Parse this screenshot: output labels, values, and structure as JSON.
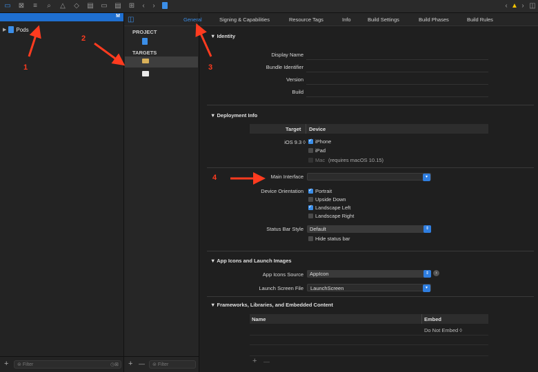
{
  "navigator": {
    "selected_badge": "M",
    "root_item": "Pods",
    "filter_placeholder": "Filter"
  },
  "target_list": {
    "project_header": "PROJECT",
    "targets_header": "TARGETS",
    "filter_placeholder": "Filter",
    "add_label": "+",
    "remove_label": "—"
  },
  "tabs": [
    {
      "label": "General",
      "active": true
    },
    {
      "label": "Signing & Capabilities"
    },
    {
      "label": "Resource Tags"
    },
    {
      "label": "Info"
    },
    {
      "label": "Build Settings"
    },
    {
      "label": "Build Phases"
    },
    {
      "label": "Build Rules"
    }
  ],
  "identity": {
    "header": "▼ Identity",
    "display_name": "Display Name",
    "bundle_identifier": "Bundle Identifier",
    "version": "Version",
    "build": "Build"
  },
  "deployment": {
    "header": "▼ Deployment Info",
    "target_col": "Target",
    "device_col": "Device",
    "ios_version": "iOS 9.3 ◊",
    "iphone": "iPhone",
    "ipad": "iPad",
    "mac": "Mac",
    "mac_note": "(requires macOS 10.15)",
    "main_interface_label": "Main Interface",
    "device_orientation_label": "Device Orientation",
    "portrait": "Portrait",
    "upside_down": "Upside Down",
    "landscape_left": "Landscape Left",
    "landscape_right": "Landscape Right",
    "status_bar_style_label": "Status Bar Style",
    "status_bar_style_value": "Default",
    "hide_status_bar": "Hide status bar"
  },
  "app_icons": {
    "header": "▼ App Icons and Launch Images",
    "source_label": "App Icons Source",
    "source_value": "AppIcon",
    "launch_label": "Launch Screen File",
    "launch_value": "LaunchScreen"
  },
  "frameworks": {
    "header": "▼ Frameworks, Libraries, and Embedded Content",
    "name_col": "Name",
    "embed_col": "Embed",
    "embed_value": "Do Not Embed ◊",
    "add_label": "+",
    "remove_label": "—"
  },
  "annotations": [
    "1",
    "2",
    "3",
    "4"
  ],
  "colors": {
    "accent": "#3b8ee8",
    "annotation": "#ff3b1f"
  }
}
